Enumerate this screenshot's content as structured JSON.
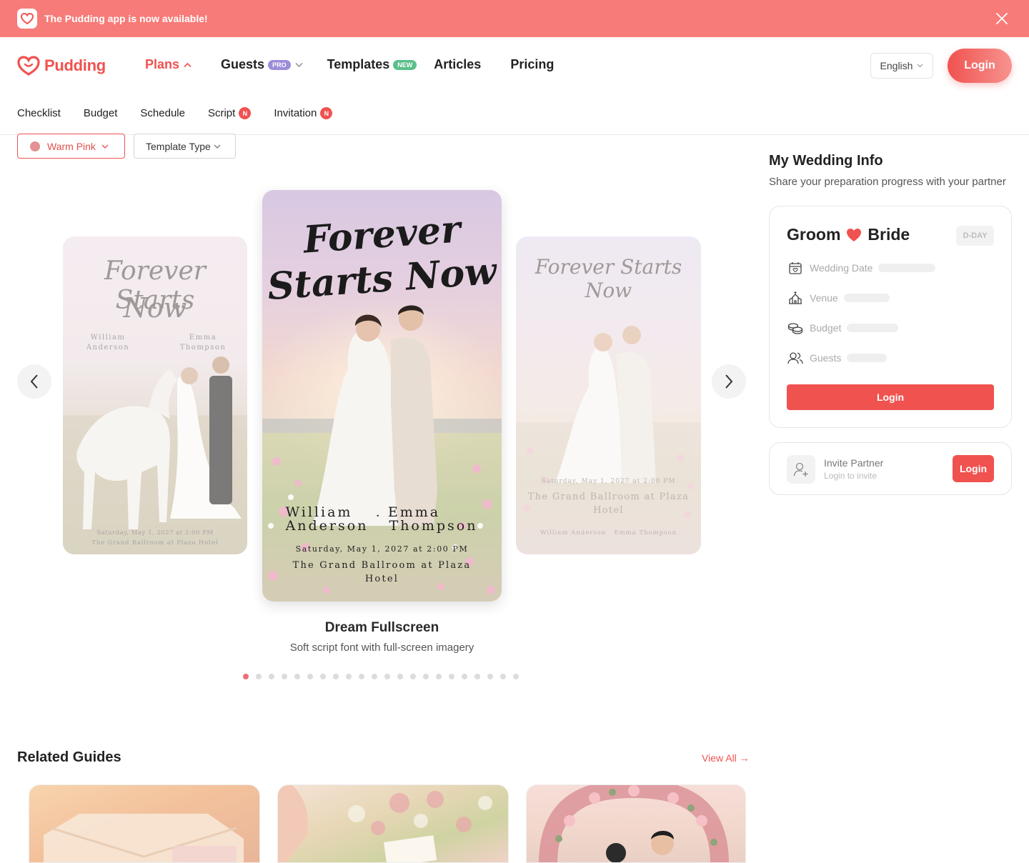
{
  "banner": {
    "text": "The Pudding app is now available!"
  },
  "header": {
    "logo_text": "Pudding",
    "nav": [
      {
        "label": "Plans",
        "active": true
      },
      {
        "label": "Guests",
        "badge": "PRO"
      },
      {
        "label": "Templates",
        "badge": "NEW"
      },
      {
        "label": "Articles"
      },
      {
        "label": "Pricing"
      }
    ],
    "language": "English",
    "login_label": "Login"
  },
  "subnav": [
    {
      "label": "Checklist"
    },
    {
      "label": "Budget"
    },
    {
      "label": "Schedule"
    },
    {
      "label": "Script",
      "badge": "N"
    },
    {
      "label": "Invitation",
      "badge": "N"
    }
  ],
  "filters": {
    "color": {
      "label": "Warm Pink",
      "swatch": "#e39194"
    },
    "type": {
      "label": "Template Type"
    }
  },
  "carousel": {
    "left_card": {
      "script_title_1": "Forever Starts",
      "script_title_2": "Now",
      "groom_1": "William",
      "groom_2": "Anderson",
      "bride_1": "Emma",
      "bride_2": "Thompson",
      "date": "Saturday, May 1, 2027 at 2:00 PM",
      "venue": "The Grand Ballroom at Plaza Hotel"
    },
    "center_card": {
      "script_title_1": "Forever",
      "script_title_2": "Starts Now",
      "groom_1": "William",
      "groom_2": "Anderson",
      "bride_1": "Emma",
      "bride_2": "Thompson",
      "separator": "·",
      "date": "Saturday, May 1, 2027 at 2:00 PM",
      "venue_1": "The Grand Ballroom at Plaza",
      "venue_2": "Hotel"
    },
    "right_card": {
      "script_title": "Forever Starts Now",
      "date": "Saturday, May 1, 2027 at 2:00 PM",
      "venue_1": "The Grand Ballroom at Plaza",
      "venue_2": "Hotel",
      "names": "William Anderson   Emma Thompson"
    },
    "title": "Dream Fullscreen",
    "description": "Soft script font with full-screen imagery",
    "page_count": 22,
    "current_page": 1
  },
  "sidebar": {
    "title": "My Wedding Info",
    "subtitle": "Share your preparation progress with your partner",
    "groom": "Groom",
    "bride": "Bride",
    "dday": "D-DAY",
    "rows": [
      {
        "label": "Wedding Date",
        "icon": "calendar-heart-icon"
      },
      {
        "label": "Venue",
        "icon": "church-icon"
      },
      {
        "label": "Budget",
        "icon": "coins-icon"
      },
      {
        "label": "Guests",
        "icon": "users-icon"
      }
    ],
    "login_label": "Login",
    "partner": {
      "title": "Invite Partner",
      "subtitle": "Login to invite",
      "login_label": "Login"
    }
  },
  "guides": {
    "title": "Related Guides",
    "view_all": "View All →"
  },
  "colors": {
    "brand": "#f0524f",
    "banner": "#f77b78",
    "dot_active": "#ee6f77"
  }
}
